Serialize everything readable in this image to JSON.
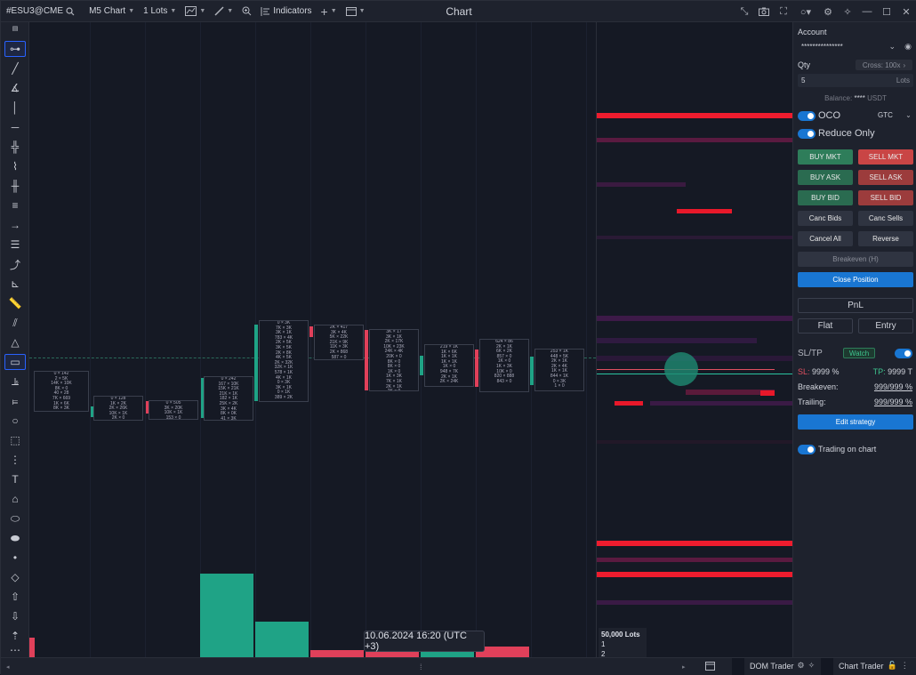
{
  "topbar": {
    "symbol": "#ESU3@CME",
    "chart_type": "M5 Chart",
    "lots": "1 Lots",
    "indicators": "Indicators",
    "title": "Chart"
  },
  "panel": {
    "account_label": "Account",
    "account_value": "***************",
    "qty_label": "Qty",
    "cross": "Cross: 100x",
    "qty_value": "5",
    "qty_unit": "Lots",
    "balance_label": "Balance:",
    "balance_value": "****",
    "balance_unit": "USDT",
    "oco_label": "OCO",
    "tif": "GTC",
    "reduce_only_label": "Reduce Only",
    "buttons": {
      "buy_mkt": "BUY MKT",
      "sell_mkt": "SELL MKT",
      "buy_ask": "BUY ASK",
      "sell_ask": "SELL ASK",
      "buy_bid": "BUY BID",
      "sell_bid": "SELL BID",
      "canc_bids": "Canc Bids",
      "canc_sells": "Canc Sells",
      "cancel_all": "Cancel All",
      "reverse": "Reverse",
      "breakeven": "Breakeven (H)",
      "close_position": "Close Position",
      "pnl": "PnL",
      "flat": "Flat",
      "entry": "Entry",
      "edit_strategy": "Edit strategy"
    },
    "sltp_label": "SL/TP",
    "watch": "Watch",
    "sl_label": "SL:",
    "sl_value": "9999 %",
    "tp_label": "TP:",
    "tp_value": "9999 T",
    "breakeven_label": "Breakeven:",
    "breakeven_value": "999/999 %",
    "trailing_label": "Trailing:",
    "trailing_value": "999/999 %",
    "trading_on_chart": "Trading on chart"
  },
  "chart": {
    "tooltip": "10.06.2024 16:20 (UTC +3)",
    "lots_box": {
      "title": "50,000  Lots",
      "line1": "1",
      "line2": "2"
    }
  },
  "footprints": [
    {
      "rows": [
        "0 × 142",
        "2 × 5K",
        "14K × 10K",
        "8K × 0",
        "40 × 28",
        "7K × 669",
        "1K × 6K",
        "8K × 3K"
      ]
    },
    {
      "rows": [
        "0 × 128",
        "1K × 2K",
        "2K × 26K",
        "10K × 1K",
        "2K × 0"
      ]
    },
    {
      "rows": [
        "0 × 505",
        "3K × 20K",
        "10K × 1K",
        "153 × 0"
      ]
    },
    {
      "rows": [
        "0 × 242",
        "167 × 10K",
        "15K × 21K",
        "21K × 1K",
        "182 × 1K",
        "25K × 2K",
        "3K × 4K",
        "8K × 0K",
        "41 × 3K"
      ]
    },
    {
      "rows": [
        "0 × 3K",
        "7K × 3K",
        "3K × 1K",
        "783 × 4K",
        "2K × 5K",
        "3K × 5K",
        "2K × 8K",
        "4K × 5K",
        "2K × 32K",
        "32K × 1K",
        "578 × 1K",
        "4K × 1K",
        "0 × 3K",
        "3K × 1K",
        "0 × 1K",
        "389 × 2K"
      ]
    },
    {
      "rows": [
        "2K × 417",
        "3K × 4K",
        "5K × 22K",
        "21K × 9K",
        "11K × 3K",
        "2K × 868",
        "587 × 0"
      ]
    },
    {
      "rows": [
        "3K × 17",
        "3K × 1K",
        "2K × 17K",
        "10K × 23K",
        "24K × 4K",
        "20K × 0",
        "8K × 0",
        "8K × 0",
        "1K × 0",
        "1K × 3K",
        "7K × 1K",
        "2K × 1K",
        "2K × 0"
      ]
    },
    {
      "rows": [
        "219 × 1K",
        "1K × 6K",
        "1K × 1K",
        "1K × 1K",
        "1K × 0",
        "948 × 7K",
        "2K × 1K",
        "2K × 24K"
      ]
    },
    {
      "rows": [
        "624 × 86",
        "2K × 1K",
        "6K × 2K",
        "857 × 0",
        "1K × 0",
        "1K × 3K",
        "10K × 0",
        "820 × 888",
        "843 × 0"
      ]
    },
    {
      "rows": [
        "253 × 1K",
        "448 × 5K",
        "2K × 1K",
        "2K × 4K",
        "1K × 1K",
        "844 × 1K",
        "0 × 3K",
        "1 × 0"
      ]
    }
  ],
  "bottombar": {
    "dom_trader": "DOM Trader",
    "chart_trader": "Chart Trader"
  }
}
